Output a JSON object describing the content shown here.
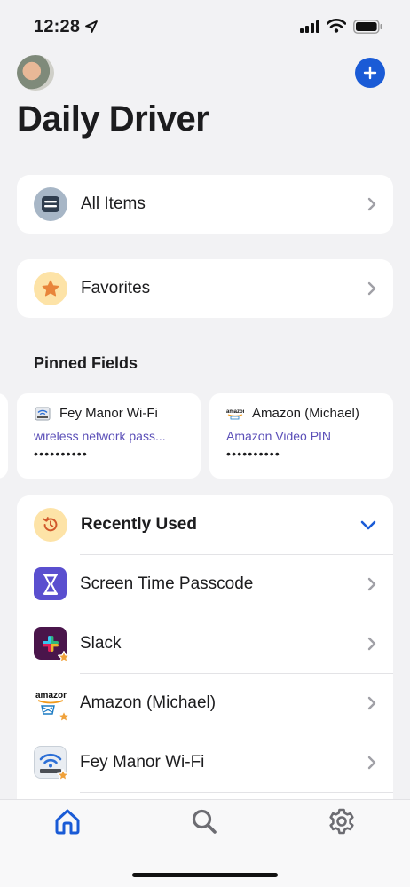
{
  "status": {
    "time": "12:28"
  },
  "header": {
    "title": "Daily Driver"
  },
  "rows": {
    "all_items": "All Items",
    "favorites": "Favorites"
  },
  "pinned": {
    "heading": "Pinned Fields",
    "cards": [
      {
        "title": "Fey Manor Wi-Fi",
        "field": "wireless network pass...",
        "value": "••••••••••"
      },
      {
        "title": "Amazon (Michael)",
        "field": "Amazon Video PIN",
        "value": "••••••••••"
      }
    ]
  },
  "recent": {
    "heading": "Recently Used",
    "items": [
      {
        "label": "Screen Time Passcode",
        "icon": "hourglass-icon"
      },
      {
        "label": "Slack",
        "icon": "slack-icon"
      },
      {
        "label": "Amazon (Michael)",
        "icon": "amazon-icon"
      },
      {
        "label": "Fey Manor Wi-Fi",
        "icon": "wifi-router-icon"
      }
    ]
  },
  "colors": {
    "accent": "#1a5bd6",
    "link": "#5b4fb8",
    "favorite": "#f0a13a",
    "recent_icon_bg": "#fde3a7"
  },
  "tabs": [
    "home-icon",
    "search-icon",
    "gear-icon"
  ]
}
